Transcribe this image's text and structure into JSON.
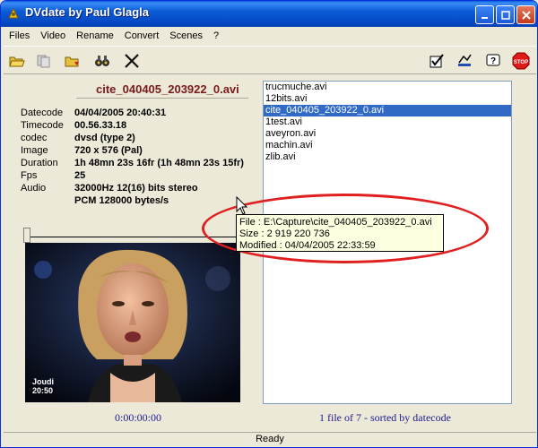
{
  "window": {
    "title": "DVdate by Paul Glagla"
  },
  "menu": [
    "Files",
    "Video",
    "Rename",
    "Convert",
    "Scenes",
    "?"
  ],
  "toolbar_left": [
    "open-folder-icon",
    "copy-icon",
    "folder-add-icon",
    "binoculars-icon",
    "tools-icon"
  ],
  "toolbar_right": [
    "checkbox-icon",
    "sign-icon",
    "help-icon",
    "stop-icon"
  ],
  "file": {
    "title": "cite_040405_203922_0.avi",
    "info": [
      {
        "label": "Datecode",
        "value": "04/04/2005 20:40:31"
      },
      {
        "label": "Timecode",
        "value": "00.56.33.18"
      },
      {
        "label": "codec",
        "value": "dvsd (type 2)"
      },
      {
        "label": "Image",
        "value": "720 x 576 (Pal)"
      },
      {
        "label": "Duration",
        "value": "1h 48mn 23s 16fr (1h 48mn 23s 15fr)"
      },
      {
        "label": "Fps",
        "value": "25"
      },
      {
        "label": "Audio",
        "value": "32000Hz 12(16) bits  stereo"
      },
      {
        "label": "",
        "value": "PCM 128000 bytes/s"
      }
    ]
  },
  "files": [
    "trucmuche.avi",
    "12bits.avi",
    "cite_040405_203922_0.avi",
    "1test.avi",
    "aveyron.avi",
    "machin.avi",
    "zlib.avi"
  ],
  "selected_index": 2,
  "tooltip": {
    "file": "File    : E:\\Capture\\cite_040405_203922_0.avi",
    "size": "Size    : 2 919 220 736",
    "modified": "Modified : 04/04/2005 22:33:59"
  },
  "video": {
    "overlay_line1": "Joudi",
    "overlay_line2": "20:50"
  },
  "timecode_display": "0:00:00:00",
  "file_status": "1 file of 7 - sorted by datecode",
  "status": "Ready",
  "colors": {
    "title_bar": "#0a5fdc",
    "selection": "#316ac5",
    "annotation_circle": "#e02020"
  }
}
